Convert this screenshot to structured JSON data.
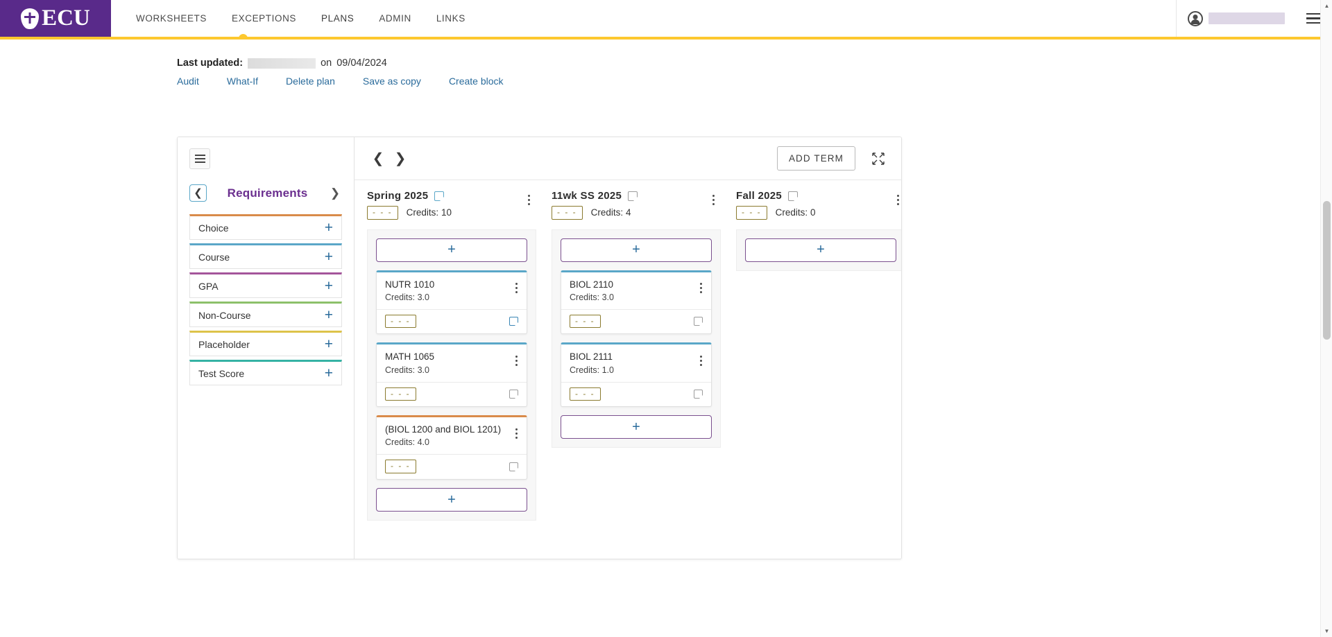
{
  "header": {
    "brand": "ECU",
    "nav": [
      {
        "label": "WORKSHEETS",
        "active": false
      },
      {
        "label": "EXCEPTIONS",
        "active": false
      },
      {
        "label": "PLANS",
        "active": true
      },
      {
        "label": "ADMIN",
        "active": false
      },
      {
        "label": "LINKS",
        "active": false
      }
    ],
    "user_name": "",
    "menu_icon": "hamburger-icon",
    "avatar_icon": "user-avatar-icon",
    "brand_color": "#592a8a",
    "accent_color": "#fdc82f"
  },
  "meta": {
    "last_updated_label": "Last updated:",
    "updated_by": "",
    "on_word": "on",
    "date": "09/04/2024"
  },
  "plan_links": [
    {
      "label": "Audit"
    },
    {
      "label": "What-If"
    },
    {
      "label": "Delete plan"
    },
    {
      "label": "Save as copy"
    },
    {
      "label": "Create block"
    }
  ],
  "requirements": {
    "panel_title": "Requirements",
    "back_icon": "chevron-left-icon",
    "forward_icon": "chevron-right-icon",
    "menu_icon": "list-menu-icon",
    "add_symbol": "+",
    "items": [
      {
        "label": "Choice",
        "color": "#d98b4a"
      },
      {
        "label": "Course",
        "color": "#5aa7c8"
      },
      {
        "label": "GPA",
        "color": "#a4559b"
      },
      {
        "label": "Non-Course",
        "color": "#8cc06a"
      },
      {
        "label": "Placeholder",
        "color": "#ddc34a"
      },
      {
        "label": "Test Score",
        "color": "#35b2a4"
      }
    ]
  },
  "terms_toolbar": {
    "prev_icon": "chevron-left-icon",
    "next_icon": "chevron-right-icon",
    "add_term_label": "ADD TERM",
    "expand_icon": "expand-collapse-icon"
  },
  "terms": [
    {
      "title": "Spring 2025",
      "note_icon": "note-icon",
      "grade_box": "- - -",
      "credits_label": "Credits:",
      "credits_value": "10",
      "kebab_icon": "more-options-icon",
      "add_top_label": "+",
      "add_bottom_label": "+",
      "has_bottom_add": true,
      "courses": [
        {
          "code": "NUTR 1010",
          "credits_label": "Credits:",
          "credits": "3.0",
          "color": "#5aa7c8",
          "grade_box": "- - -",
          "note_style": "blue"
        },
        {
          "code": "MATH 1065",
          "credits_label": "Credits:",
          "credits": "3.0",
          "color": "#5aa7c8",
          "grade_box": "- - -",
          "note_style": "gray"
        },
        {
          "code": "(BIOL 1200 and BIOL 1201)",
          "credits_label": "Credits:",
          "credits": "4.0",
          "color": "#d98b4a",
          "grade_box": "- - -",
          "note_style": "gray"
        }
      ]
    },
    {
      "title": "11wk SS 2025",
      "note_icon": "note-icon",
      "grade_box": "- - -",
      "credits_label": "Credits:",
      "credits_value": "4",
      "kebab_icon": "more-options-icon",
      "add_top_label": "+",
      "add_bottom_label": "+",
      "has_bottom_add": true,
      "courses": [
        {
          "code": "BIOL 2110",
          "credits_label": "Credits:",
          "credits": "3.0",
          "color": "#5aa7c8",
          "grade_box": "- - -",
          "note_style": "gray"
        },
        {
          "code": "BIOL 2111",
          "credits_label": "Credits:",
          "credits": "1.0",
          "color": "#5aa7c8",
          "grade_box": "- - -",
          "note_style": "gray"
        }
      ]
    },
    {
      "title": "Fall 2025",
      "note_icon": "note-icon",
      "grade_box": "- - -",
      "credits_label": "Credits:",
      "credits_value": "0",
      "kebab_icon": "more-options-icon",
      "add_top_label": "+",
      "add_bottom_label": "+",
      "has_bottom_add": false,
      "courses": []
    }
  ],
  "scrollbar": {
    "up_arrow": "▲",
    "down_arrow": "▼"
  }
}
